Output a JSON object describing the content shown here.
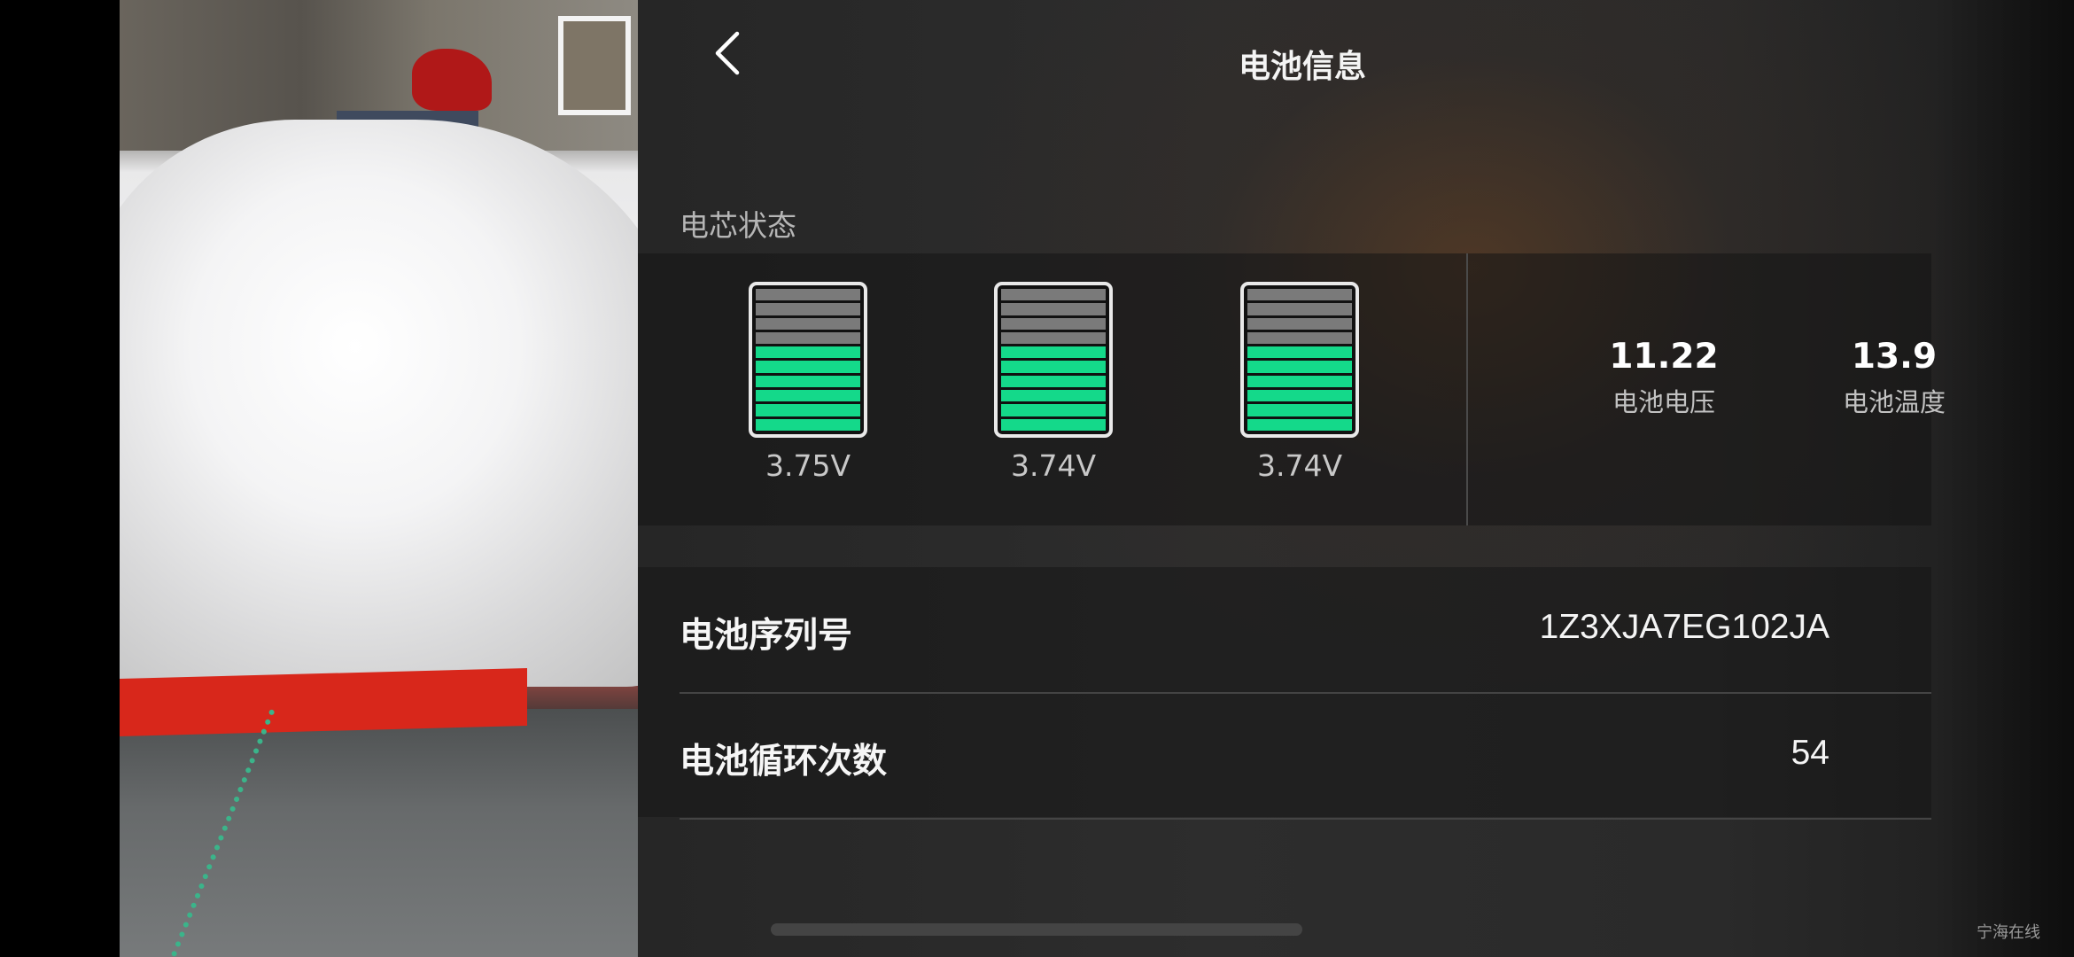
{
  "header": {
    "title": "电池信息",
    "back_icon": "chevron-left-icon"
  },
  "cells_section": {
    "label": "电芯状态",
    "cells": [
      {
        "voltage": "3.75V",
        "level_fraction": 0.6
      },
      {
        "voltage": "3.74V",
        "level_fraction": 0.6
      },
      {
        "voltage": "3.74V",
        "level_fraction": 0.6
      }
    ],
    "stats": {
      "voltage": {
        "value": "11.22",
        "label": "电池电压"
      },
      "temperature": {
        "value": "13.9",
        "label": "电池温度"
      }
    }
  },
  "info": {
    "serial": {
      "label": "电池序列号",
      "value": "1Z3XJA7EG102JA"
    },
    "cycles": {
      "label": "电池循环次数",
      "value": "54"
    }
  },
  "watermark": "宁海在线",
  "colors": {
    "cell_on": "#14d98a",
    "cell_off": "#7a7a7a",
    "panel_bg": "#2a2a2a"
  }
}
